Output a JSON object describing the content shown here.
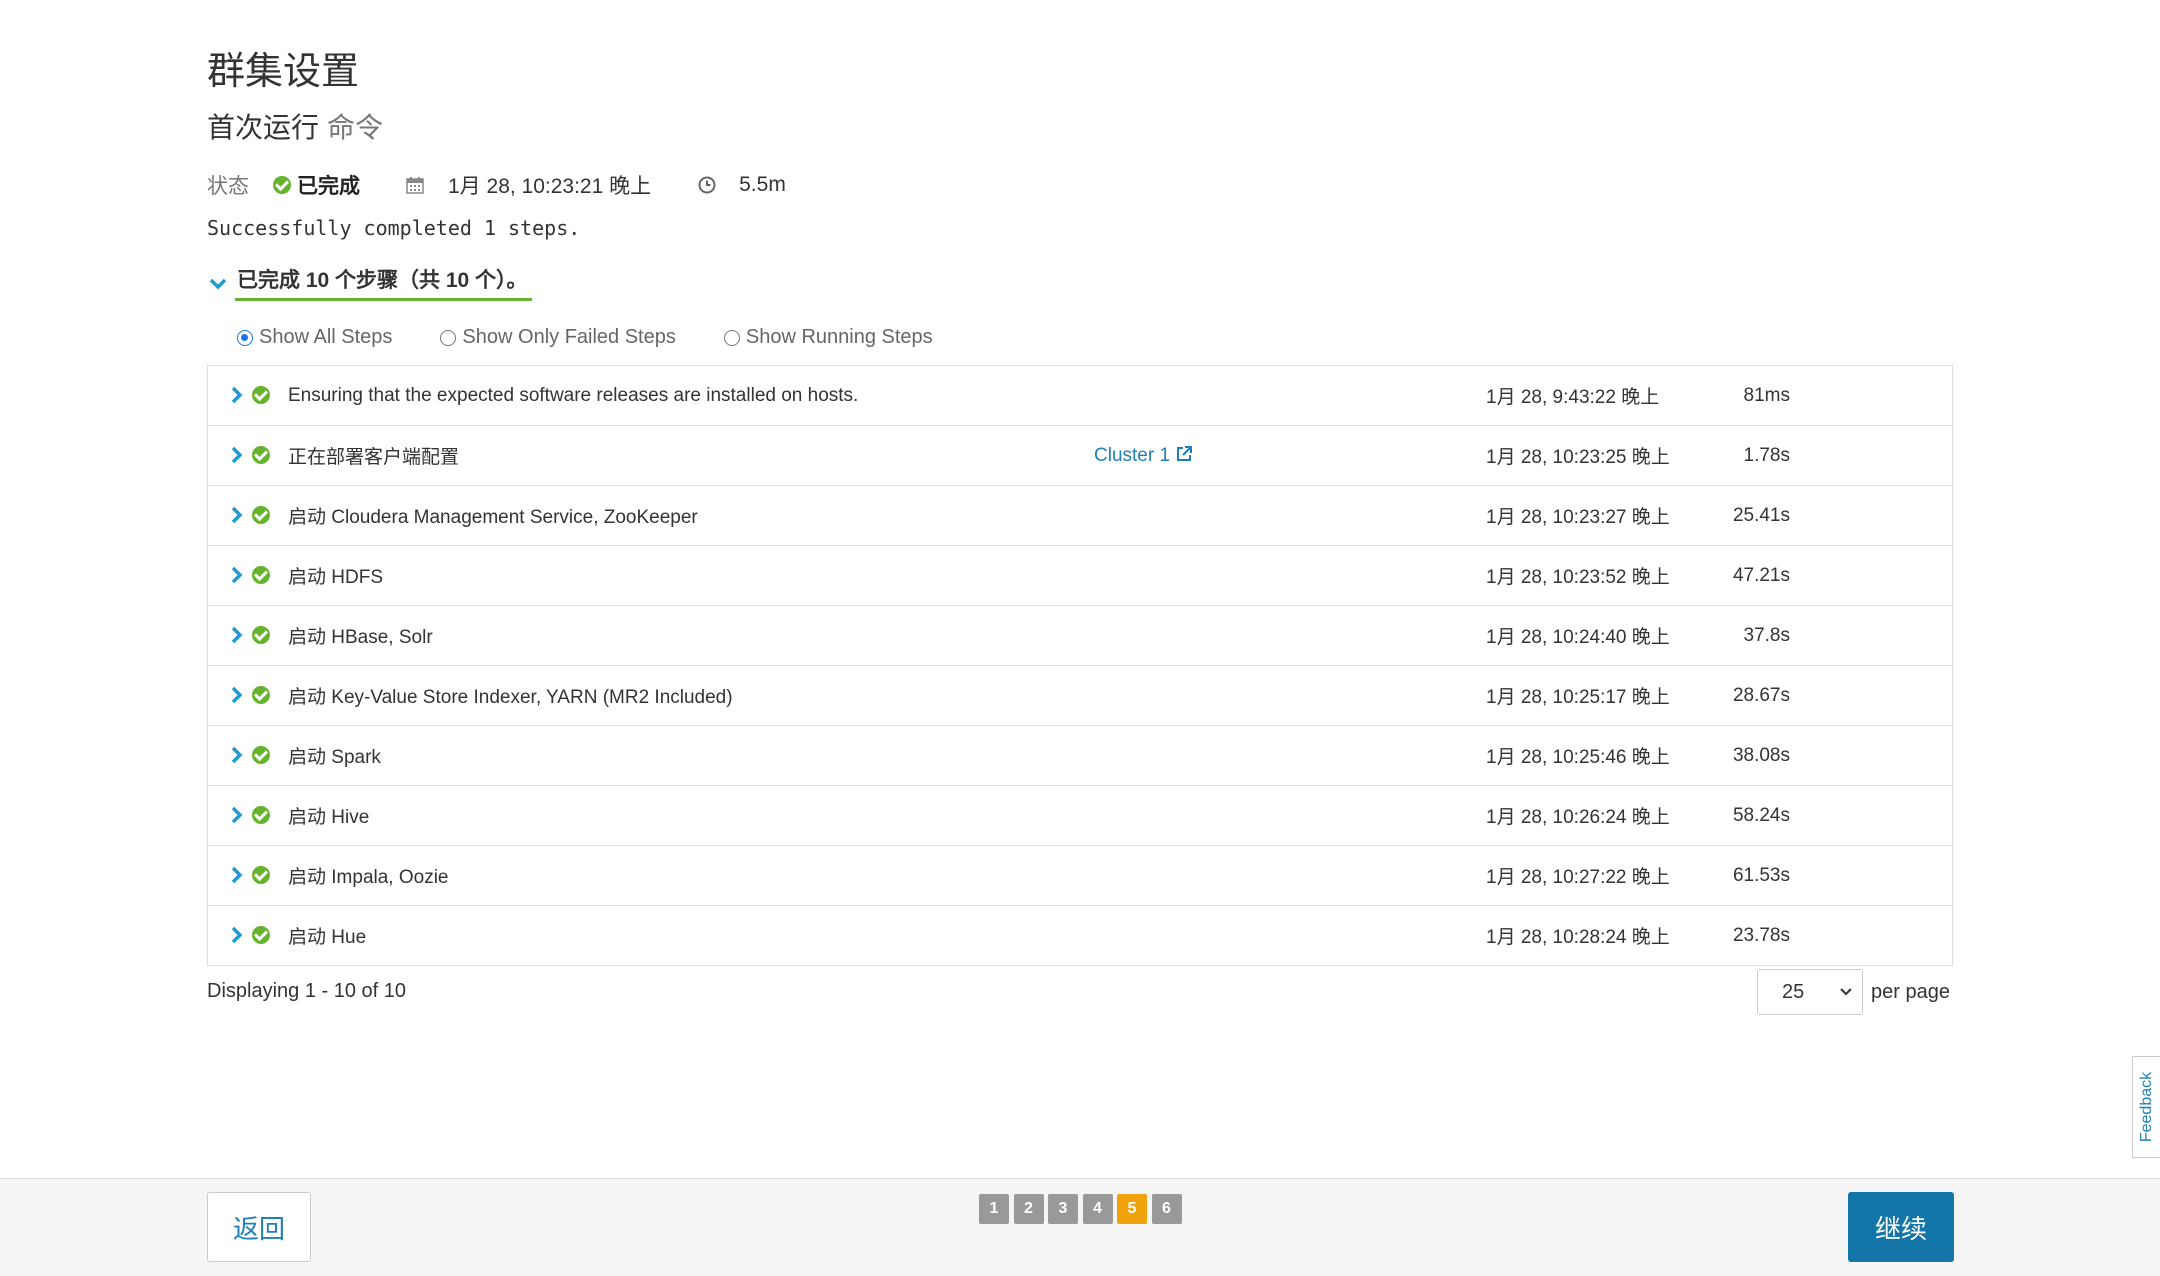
{
  "page": {
    "title": "群集设置",
    "subtitle_main": "首次运行",
    "subtitle_sub": "命令"
  },
  "status": {
    "label": "状态",
    "value": "已完成",
    "timestamp": "1月 28, 10:23:21 晚上",
    "duration": "5.5m",
    "message": "Successfully completed 1 steps."
  },
  "steps_toggle": {
    "label": "已完成 10 个步骤（共 10 个）。"
  },
  "filters": [
    {
      "label": "Show All Steps",
      "selected": true
    },
    {
      "label": "Show Only Failed Steps",
      "selected": false
    },
    {
      "label": "Show Running Steps",
      "selected": false
    }
  ],
  "rows": [
    {
      "desc": "Ensuring that the expected software releases are installed on hosts.",
      "link": "",
      "ts": "1月 28, 9:43:22 晚上",
      "dur": "81ms"
    },
    {
      "desc": "正在部署客户端配置",
      "link": "Cluster 1",
      "ts": "1月 28, 10:23:25 晚上",
      "dur": "1.78s"
    },
    {
      "desc": "启动 Cloudera Management Service, ZooKeeper",
      "link": "",
      "ts": "1月 28, 10:23:27 晚上",
      "dur": "25.41s"
    },
    {
      "desc": "启动 HDFS",
      "link": "",
      "ts": "1月 28, 10:23:52 晚上",
      "dur": "47.21s"
    },
    {
      "desc": "启动 HBase, Solr",
      "link": "",
      "ts": "1月 28, 10:24:40 晚上",
      "dur": "37.8s"
    },
    {
      "desc": "启动 Key-Value Store Indexer, YARN (MR2 Included)",
      "link": "",
      "ts": "1月 28, 10:25:17 晚上",
      "dur": "28.67s"
    },
    {
      "desc": "启动 Spark",
      "link": "",
      "ts": "1月 28, 10:25:46 晚上",
      "dur": "38.08s"
    },
    {
      "desc": "启动 Hive",
      "link": "",
      "ts": "1月 28, 10:26:24 晚上",
      "dur": "58.24s"
    },
    {
      "desc": "启动 Impala, Oozie",
      "link": "",
      "ts": "1月 28, 10:27:22 晚上",
      "dur": "61.53s"
    },
    {
      "desc": "启动 Hue",
      "link": "",
      "ts": "1月 28, 10:28:24 晚上",
      "dur": "23.78s"
    }
  ],
  "pagination": {
    "displaying": "Displaying 1 - 10 of 10",
    "per_page_value": "25",
    "per_page_label": "per page"
  },
  "footer": {
    "back_label": "返回",
    "continue_label": "继续",
    "wizard_steps": [
      "1",
      "2",
      "3",
      "4",
      "5",
      "6"
    ],
    "active_step": "5"
  },
  "feedback_label": "Feedback",
  "colors": {
    "success": "#66b32e",
    "link": "#1f7fb8",
    "primary": "#1476a8",
    "active_step": "#f0a30a"
  },
  "icons": {
    "status": "check-circle-icon",
    "date": "calendar-icon",
    "duration": "clock-icon",
    "expand": "chevron-right-icon",
    "external": "external-link-icon"
  }
}
